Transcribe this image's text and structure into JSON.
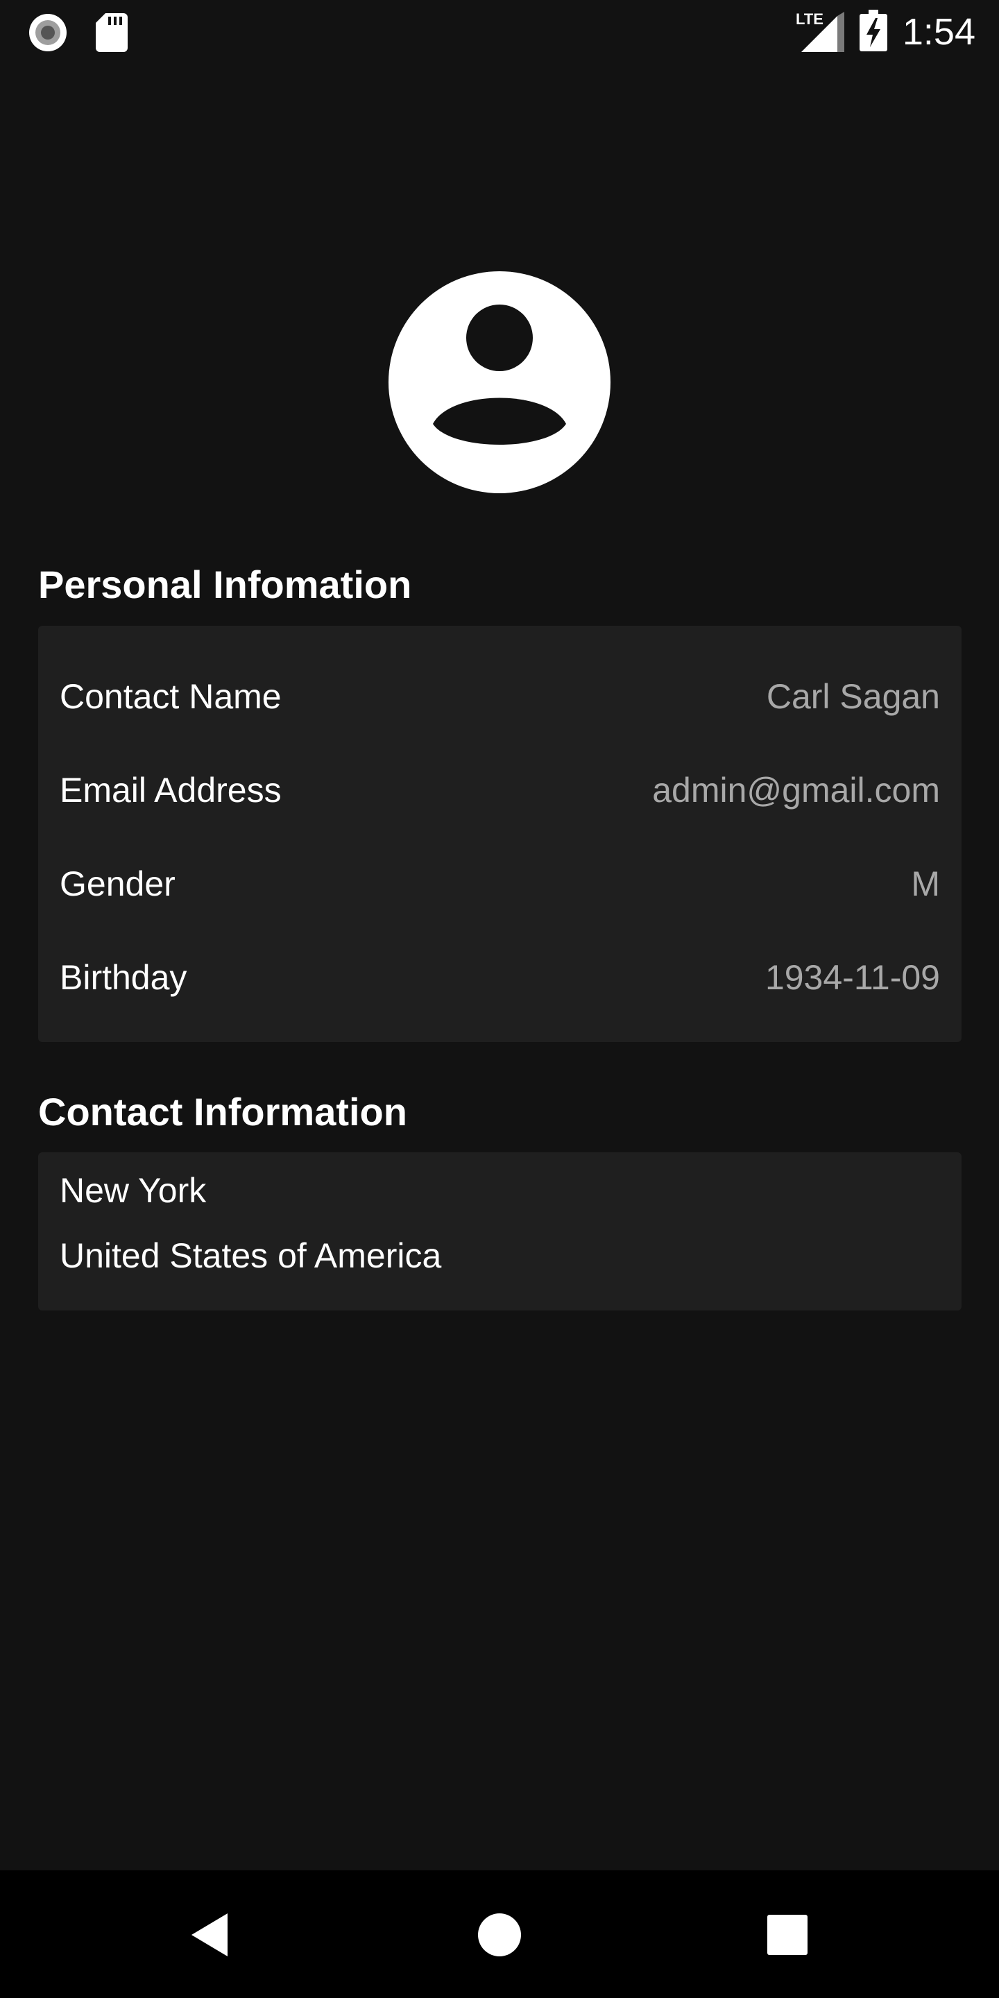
{
  "status_bar": {
    "time": "1:54",
    "network": "LTE",
    "icons": [
      "record-icon",
      "sd-card-icon",
      "signal-icon",
      "battery-charging-icon"
    ]
  },
  "profile": {
    "avatar_icon": "account-circle-icon"
  },
  "personal": {
    "title": "Personal Infomation",
    "rows": [
      {
        "label": "Contact Name",
        "value": "Carl Sagan"
      },
      {
        "label": "Email Address",
        "value": "admin@gmail.com"
      },
      {
        "label": "Gender",
        "value": "M"
      },
      {
        "label": "Birthday",
        "value": "1934-11-09"
      }
    ]
  },
  "contact": {
    "title": "Contact Information",
    "city": "New York",
    "country": "United States of America"
  },
  "nav": {
    "icons": [
      "back-icon",
      "home-icon",
      "recents-icon"
    ]
  },
  "colors": {
    "background": "#121212",
    "card": "#1f1f1f",
    "value_text": "#a8a8a8",
    "nav_bar": "#000000"
  }
}
